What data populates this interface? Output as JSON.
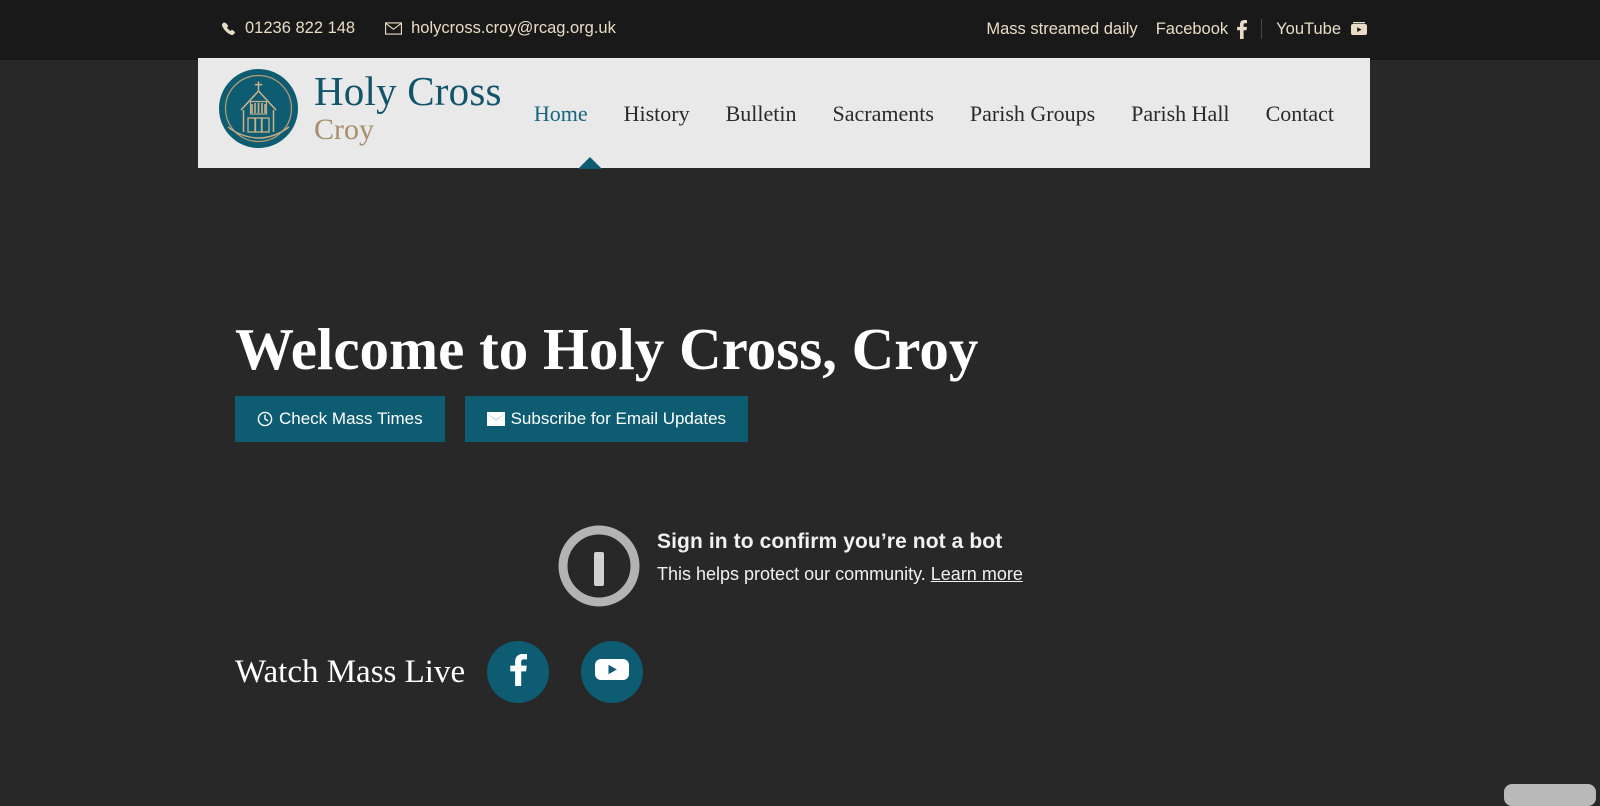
{
  "topbar": {
    "phone": {
      "icon": "phone-icon",
      "text": "01236 822 148"
    },
    "email": {
      "icon": "envelope-icon",
      "text": "holycross.croy@rcag.org.uk"
    },
    "mass_streamed": "Mass streamed daily",
    "facebook": {
      "label": "Facebook",
      "icon": "facebook-icon"
    },
    "youtube": {
      "label": "YouTube",
      "icon": "youtube-icon"
    }
  },
  "header": {
    "logo": {
      "icon": "church-logo-icon",
      "circle_color": "#0d5c72",
      "ring_color": "#b59a73"
    },
    "brand_title": "Holy Cross",
    "brand_subtitle": "Croy",
    "brand_title_color": "#12556b",
    "brand_subtitle_color": "#a98e6e",
    "nav": [
      {
        "label": "Home",
        "active": true
      },
      {
        "label": "History",
        "active": false
      },
      {
        "label": "Bulletin",
        "active": false
      },
      {
        "label": "Sacraments",
        "active": false
      },
      {
        "label": "Parish Groups",
        "active": false
      },
      {
        "label": "Parish Hall",
        "active": false
      },
      {
        "label": "Contact",
        "active": false
      }
    ]
  },
  "hero": {
    "title": "Welcome to Holy Cross, Croy",
    "buttons": [
      {
        "label": "Check Mass Times",
        "icon": "clock-icon"
      },
      {
        "label": "Subscribe for Email Updates",
        "icon": "envelope-icon"
      }
    ],
    "watch_label": "Watch Mass Live",
    "socials": [
      {
        "name": "facebook",
        "icon": "facebook-icon"
      },
      {
        "name": "youtube",
        "icon": "youtube-icon"
      }
    ]
  },
  "bot_overlay": {
    "icon": "info-circle-icon",
    "title": "Sign in to confirm you’re not a bot",
    "subtitle_prefix": "This helps protect our community. ",
    "learn_more": "Learn more"
  },
  "colors": {
    "accent_teal": "#0d5c72",
    "topbar_bg": "#191919",
    "body_bg": "#282828",
    "header_bg": "#e9e9e9",
    "topbar_text": "#e8dcc4"
  }
}
